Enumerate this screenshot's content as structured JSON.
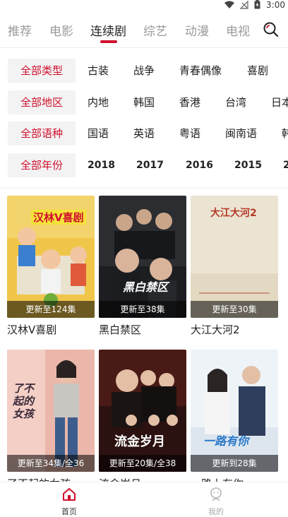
{
  "status_bar": {
    "time": "3:00"
  },
  "nav": {
    "tabs": [
      {
        "label": "推荐",
        "active": false
      },
      {
        "label": "电影",
        "active": false
      },
      {
        "label": "连续剧",
        "active": true
      },
      {
        "label": "综艺",
        "active": false
      },
      {
        "label": "动漫",
        "active": false
      },
      {
        "label": "电视",
        "active": false
      }
    ],
    "search_icon": "search-icon"
  },
  "filters": [
    {
      "tag": "全部类型",
      "options": [
        "古装",
        "战争",
        "青春偶像",
        "喜剧"
      ]
    },
    {
      "tag": "全部地区",
      "options": [
        "内地",
        "韩国",
        "香港",
        "台湾",
        "日本"
      ]
    },
    {
      "tag": "全部语种",
      "options": [
        "国语",
        "英语",
        "粤语",
        "闽南语",
        "韩"
      ]
    },
    {
      "tag": "全部年份",
      "options": [
        "2018",
        "2017",
        "2016",
        "2015",
        "2"
      ]
    }
  ],
  "shows": [
    {
      "title": "汉林V喜剧",
      "badge": "更新至124集",
      "poster_text": "汉林V喜剧"
    },
    {
      "title": "黑白禁区",
      "badge": "更新至38集",
      "poster_text": "黑白禁区"
    },
    {
      "title": "大江大河2",
      "badge": "更新至30集",
      "poster_text": "大江大河2"
    },
    {
      "title": "了不起的女孩",
      "badge": "更新至34集/全36",
      "poster_text": "了不起的女孩"
    },
    {
      "title": "流金岁月",
      "badge": "更新至20集/全38",
      "poster_text": "流金岁月"
    },
    {
      "title": "一路上有你",
      "badge": "更新到28集",
      "poster_text": "一路有你"
    }
  ],
  "bottom_nav": {
    "home": {
      "label": "首页",
      "icon": "home-icon"
    },
    "mine": {
      "label": "我的",
      "icon": "profile-icon"
    }
  },
  "colors": {
    "accent": "#d0112e",
    "tag_bg": "#f3f3f3"
  }
}
